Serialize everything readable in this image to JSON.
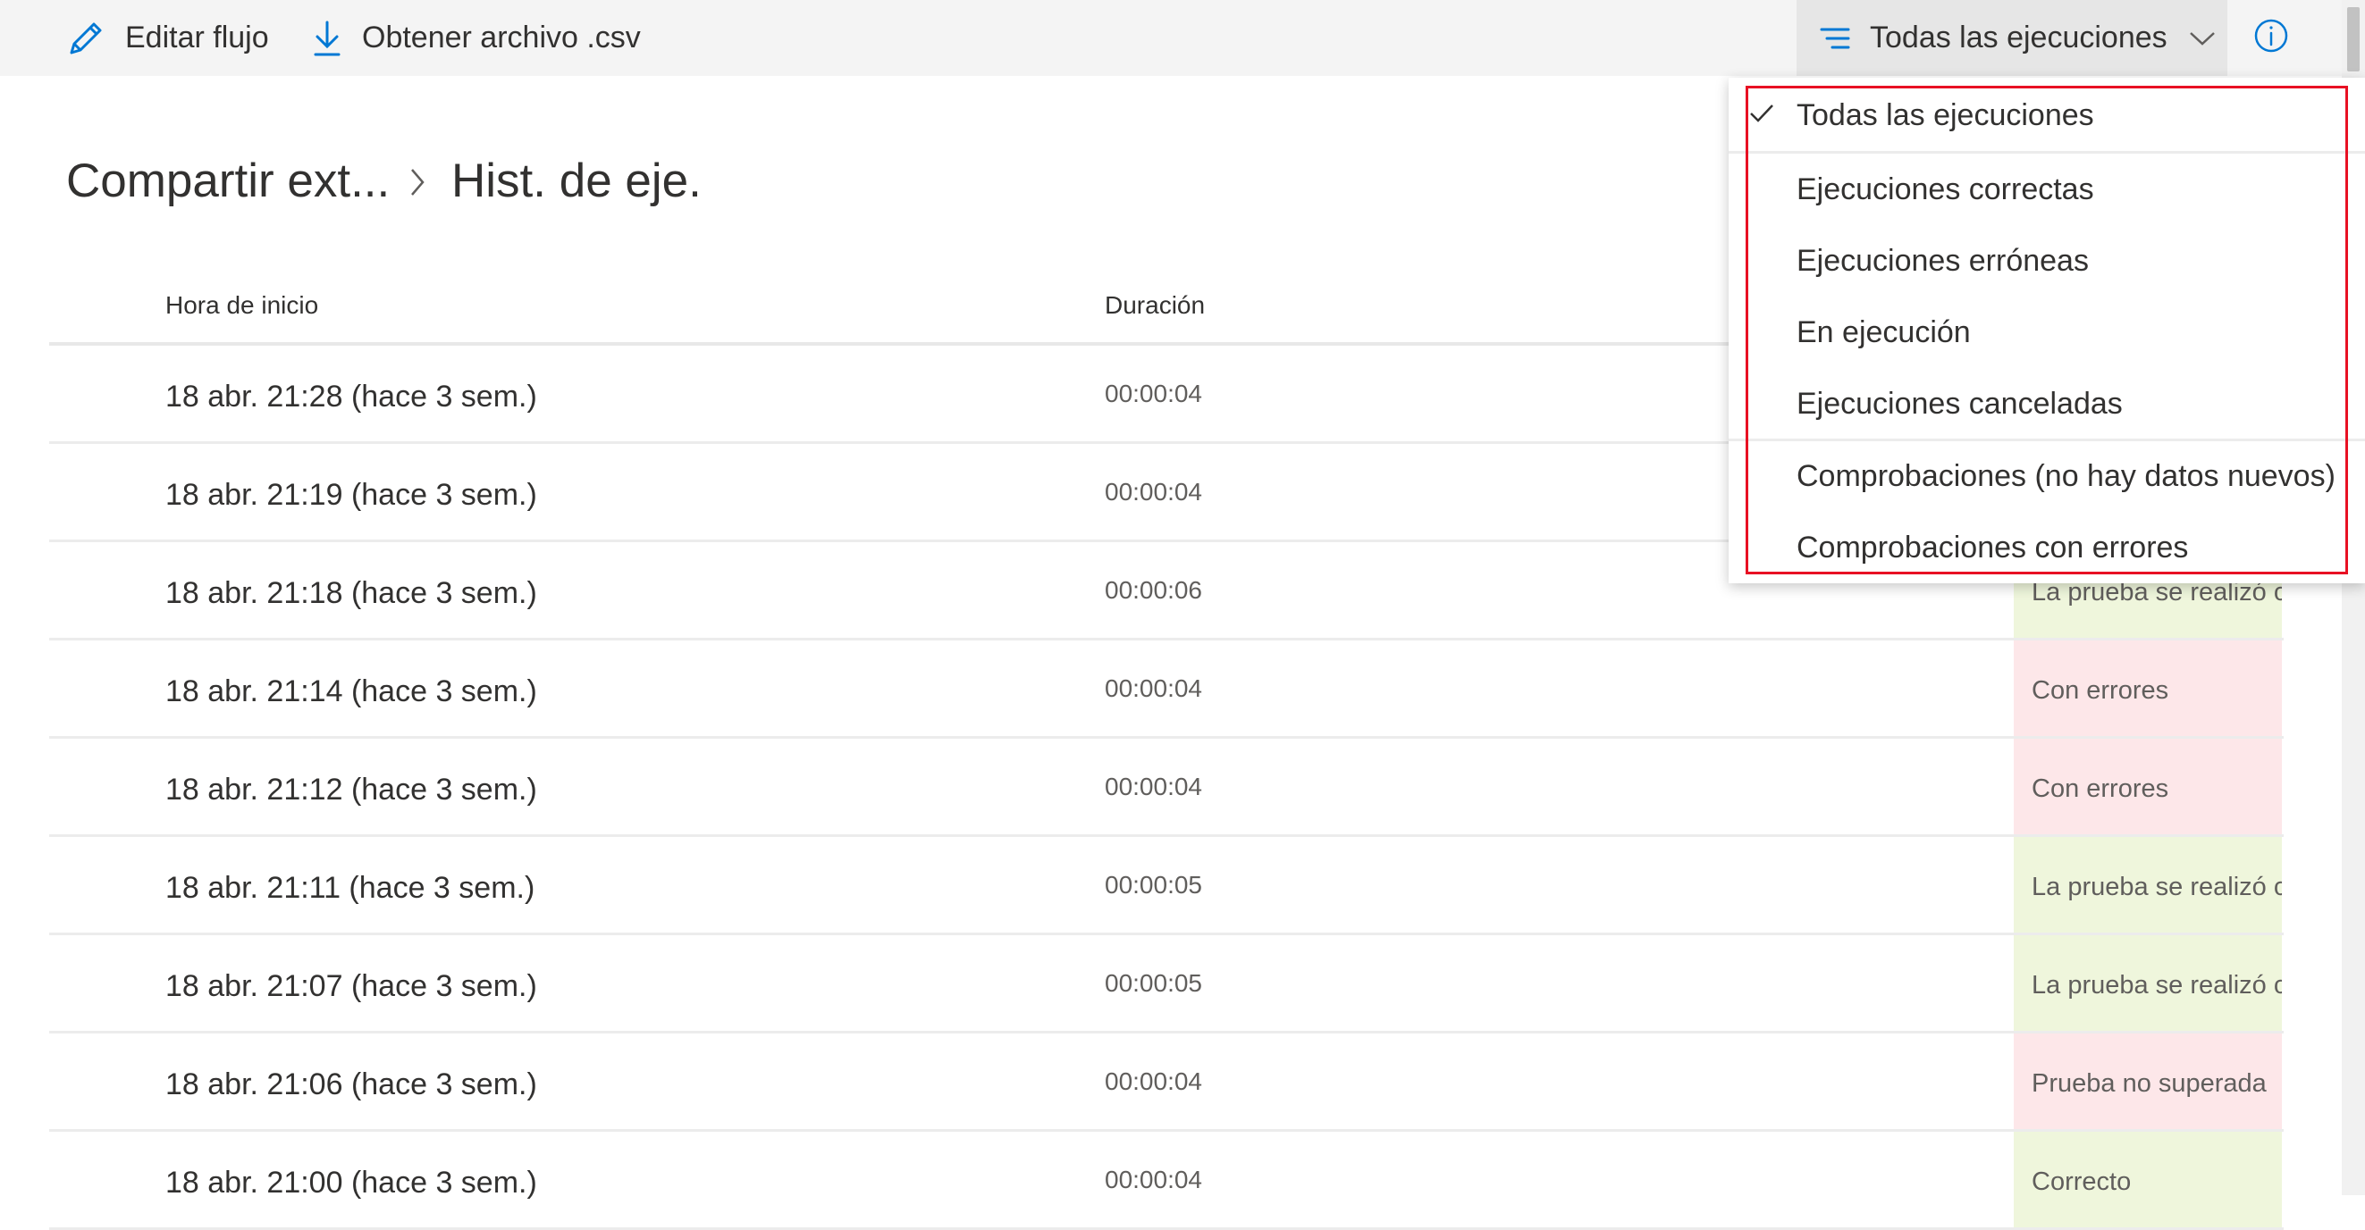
{
  "toolbar": {
    "edit_label": "Editar flujo",
    "csv_label": "Obtener archivo .csv",
    "filter_label": "Todas las ejecuciones"
  },
  "breadcrumb": {
    "item1": "Compartir ext...",
    "item2": "Hist. de eje."
  },
  "table": {
    "headers": {
      "start": "Hora de inicio",
      "duration": "Duración"
    },
    "rows": [
      {
        "start": "18 abr. 21:28 (hace 3 sem.)",
        "duration": "00:00:04",
        "status": "",
        "status_color": ""
      },
      {
        "start": "18 abr. 21:19 (hace 3 sem.)",
        "duration": "00:00:04",
        "status": "",
        "status_color": ""
      },
      {
        "start": "18 abr. 21:18 (hace 3 sem.)",
        "duration": "00:00:06",
        "status": "La prueba se realizó c",
        "status_color": "#eff6dc"
      },
      {
        "start": "18 abr. 21:14 (hace 3 sem.)",
        "duration": "00:00:04",
        "status": "Con errores",
        "status_color": "#fde7e9"
      },
      {
        "start": "18 abr. 21:12 (hace 3 sem.)",
        "duration": "00:00:04",
        "status": "Con errores",
        "status_color": "#fde7e9"
      },
      {
        "start": "18 abr. 21:11 (hace 3 sem.)",
        "duration": "00:00:05",
        "status": "La prueba se realizó c",
        "status_color": "#eff6dc"
      },
      {
        "start": "18 abr. 21:07 (hace 3 sem.)",
        "duration": "00:00:05",
        "status": "La prueba se realizó c",
        "status_color": "#eff6dc"
      },
      {
        "start": "18 abr. 21:06 (hace 3 sem.)",
        "duration": "00:00:04",
        "status": "Prueba no superada",
        "status_color": "#fde7e9"
      },
      {
        "start": "18 abr. 21:00 (hace 3 sem.)",
        "duration": "00:00:04",
        "status": "Correcto",
        "status_color": "#eff6dc"
      }
    ]
  },
  "filter_menu": {
    "items": [
      {
        "label": "Todas las ejecuciones",
        "checked": true
      },
      {
        "label": "Ejecuciones correctas",
        "checked": false
      },
      {
        "label": "Ejecuciones erróneas",
        "checked": false
      },
      {
        "label": "En ejecución",
        "checked": false
      },
      {
        "label": "Ejecuciones canceladas",
        "checked": false
      },
      {
        "label": "Comprobaciones (no hay datos nuevos)",
        "checked": false
      },
      {
        "label": "Comprobaciones con errores",
        "checked": false
      }
    ]
  },
  "icons": {
    "edit": "pencil-icon",
    "download": "download-icon",
    "filter": "filter-icon",
    "chevron": "chevron-down-icon",
    "info": "info-icon",
    "check": "checkmark-icon"
  },
  "colors": {
    "accent": "#0078d4",
    "highlight_outline": "#e81123",
    "status_success_bg": "#eff6dc",
    "status_error_bg": "#fde7e9"
  }
}
